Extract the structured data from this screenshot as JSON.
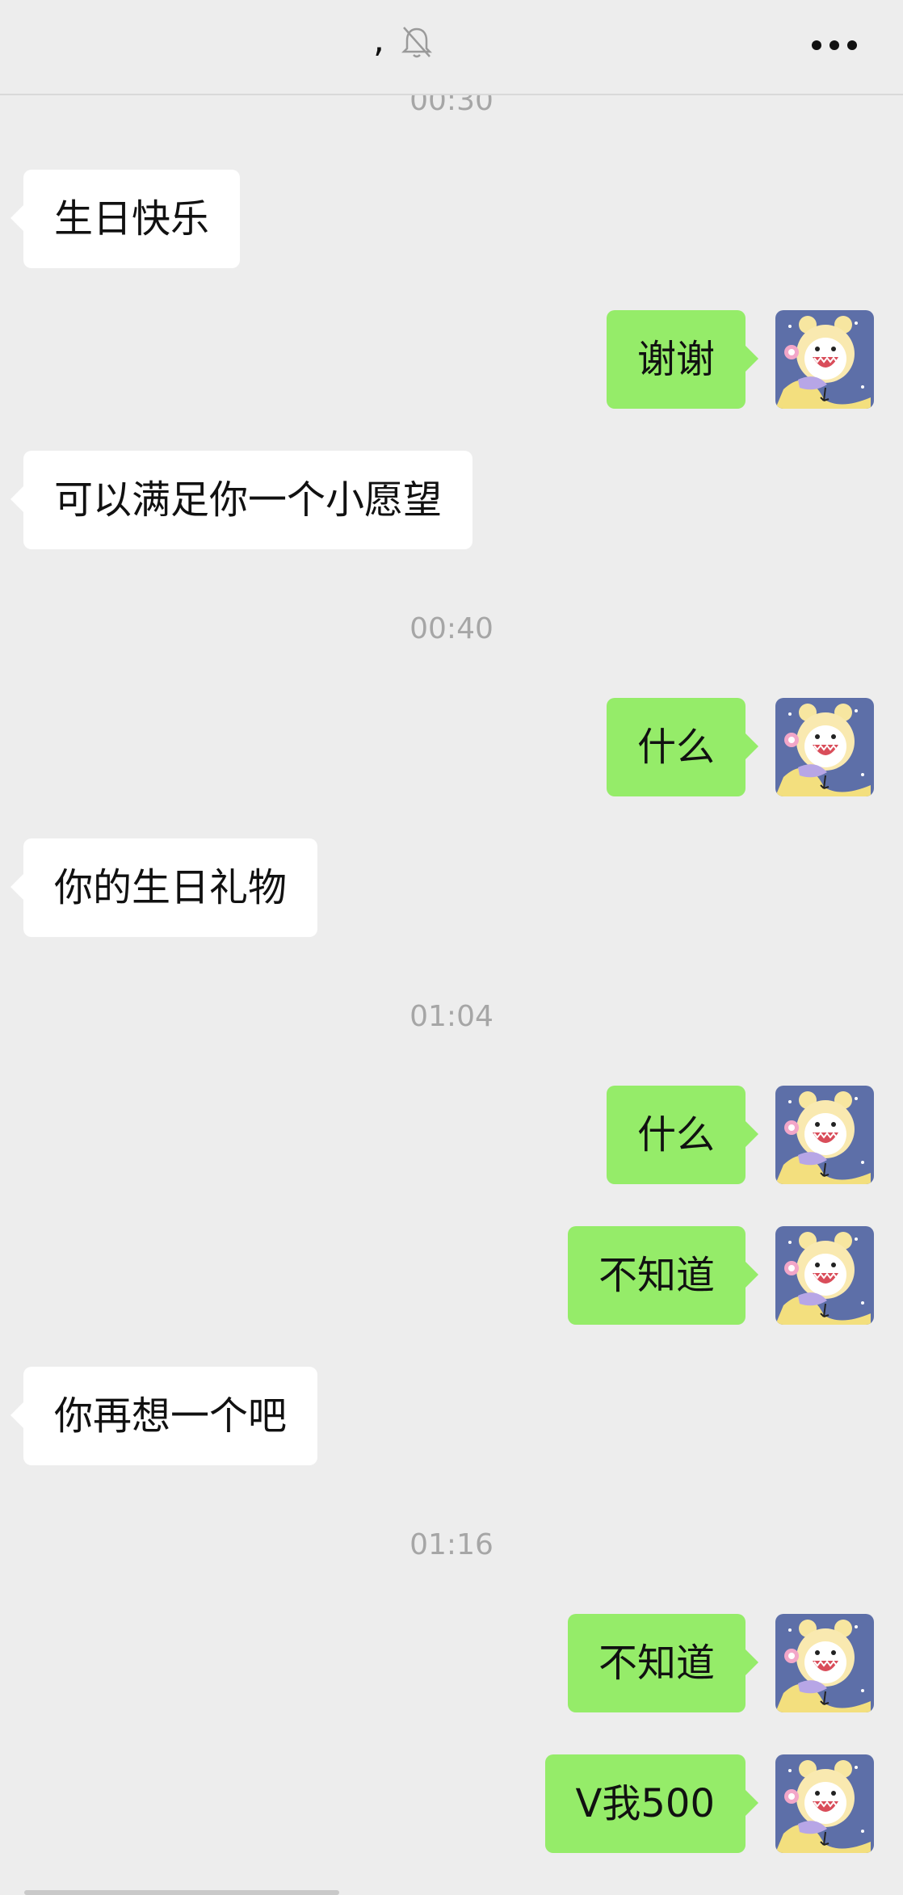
{
  "header": {
    "title": ",",
    "icons": {
      "mute": "bell-off-icon",
      "more": "more-dots-icon"
    }
  },
  "colors": {
    "background": "#ededed",
    "incoming_bubble": "#ffffff",
    "outgoing_bubble": "#95ec69",
    "timestamp": "#a6a6a6"
  },
  "messages": [
    {
      "type": "timestamp",
      "text": "00:30"
    },
    {
      "type": "incoming",
      "text": "生日快乐"
    },
    {
      "type": "outgoing",
      "text": "谢谢"
    },
    {
      "type": "incoming",
      "text": "可以满足你一个小愿望"
    },
    {
      "type": "timestamp",
      "text": "00:40"
    },
    {
      "type": "outgoing",
      "text": "什么"
    },
    {
      "type": "incoming",
      "text": "你的生日礼物"
    },
    {
      "type": "timestamp",
      "text": "01:04"
    },
    {
      "type": "outgoing",
      "text": "什么"
    },
    {
      "type": "outgoing",
      "text": "不知道"
    },
    {
      "type": "incoming",
      "text": "你再想一个吧"
    },
    {
      "type": "timestamp",
      "text": "01:16"
    },
    {
      "type": "outgoing",
      "text": "不知道"
    },
    {
      "type": "outgoing",
      "text": "V我500"
    }
  ]
}
